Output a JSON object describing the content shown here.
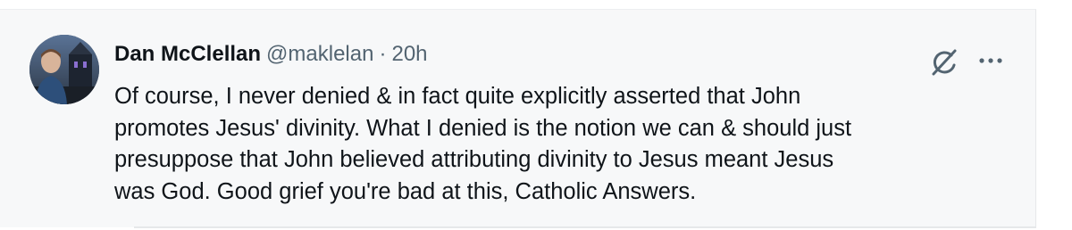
{
  "tweet": {
    "author_name": "Dan McClellan",
    "handle": "@maklelan",
    "separator": "·",
    "timestamp": "20h",
    "text": "Of course, I never denied & in fact quite explicitly asserted that John\npromotes Jesus' divinity. What I denied is the notion we can & should just\npresuppose that John believed attributing divinity to Jesus meant Jesus\nwas God. Good grief you're bad at this, Catholic Answers.",
    "icons": {
      "grok": "grok-icon",
      "more": "more-options-icon",
      "avatar": "avatar"
    }
  },
  "colors": {
    "background": "#f7f8f9",
    "text": "#0f1419",
    "secondary": "#536471"
  }
}
